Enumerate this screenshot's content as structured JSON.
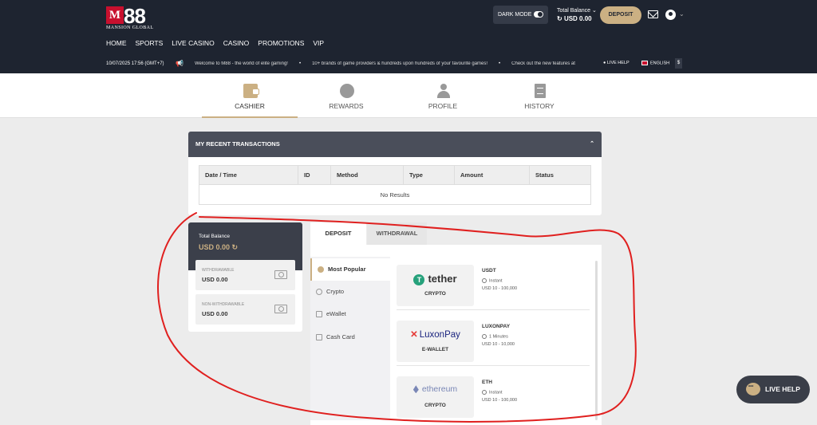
{
  "header": {
    "logo_main": "M",
    "logo_num": "88",
    "logo_sub": "MANSION GLOBAL",
    "dark_mode_label": "DARK MODE",
    "total_balance_label": "Total Balance",
    "total_balance_value": "USD 0.00",
    "deposit_label": "DEPOSIT",
    "nav": [
      "HOME",
      "SPORTS",
      "LIVE CASINO",
      "CASINO",
      "PROMOTIONS",
      "VIP"
    ],
    "datetime": "10/07/2025 17:56 (GMT+7)",
    "ticker": [
      "Welcome to M88 - the world of elite gaming!",
      "10+ brands of game providers & hundreds upon hundreds of your favourite games!",
      "Check out the new features at"
    ],
    "live_help_label": "LIVE HELP",
    "language_label": "ENGLISH",
    "currency_symbol": "$"
  },
  "tabs": [
    {
      "label": "CASHIER",
      "icon": "wallet-icon"
    },
    {
      "label": "REWARDS",
      "icon": "coins-icon"
    },
    {
      "label": "PROFILE",
      "icon": "profile-icon"
    },
    {
      "label": "HISTORY",
      "icon": "history-icon"
    }
  ],
  "transactions": {
    "title": "MY RECENT TRANSACTIONS",
    "columns": [
      "Date / Time",
      "ID",
      "Method",
      "Type",
      "Amount",
      "Status"
    ],
    "empty_text": "No Results"
  },
  "balance_card": {
    "total_label": "Total Balance",
    "total_value": "USD 0.00",
    "withdrawable_label": "WITHDRAWABLE",
    "withdrawable_value": "USD 0.00",
    "non_withdrawable_label": "NON-WITHDRAWABLE",
    "non_withdrawable_value": "USD 0.00"
  },
  "deposit": {
    "tab_deposit": "DEPOSIT",
    "tab_withdrawal": "WITHDRAWAL",
    "menu": [
      "Most Popular",
      "Crypto",
      "eWallet",
      "Cash Card"
    ],
    "methods": [
      {
        "logo": "tether",
        "category": "CRYPTO",
        "name": "USDT",
        "speed": "Instant",
        "range": "USD 10 - 100,000"
      },
      {
        "logo": "LuxonPay",
        "category": "E-WALLET",
        "name": "LUXONPAY",
        "speed": "1 Minutes",
        "range": "USD 10 - 10,000"
      },
      {
        "logo": "ethereum",
        "category": "CRYPTO",
        "name": "ETH",
        "speed": "Instant",
        "range": "USD 10 - 100,000"
      }
    ]
  },
  "live_help_button": "LIVE HELP",
  "colors": {
    "accent": "#cbb083",
    "header_bg": "#1e2430",
    "annotation": "#e0201f"
  }
}
